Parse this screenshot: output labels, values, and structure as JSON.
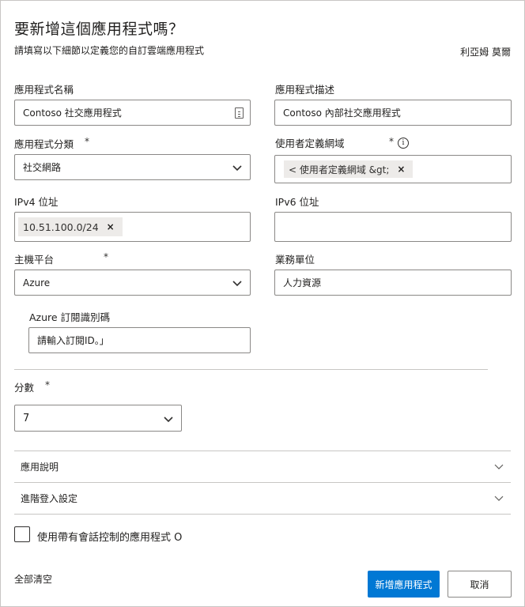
{
  "dialog": {
    "title": "要新增這個應用程式嗎？",
    "subtitle": "請填寫以下細節以定義您的自訂雲端應用程式",
    "user_name": "利亞姆 莫爾"
  },
  "fields": {
    "app_name": {
      "label": "應用程式名稱",
      "value": "Contoso 社交應用程式"
    },
    "app_description": {
      "label": "應用程式描述",
      "value": "Contoso 內部社交應用程式"
    },
    "app_category": {
      "label": "應用程式分類",
      "required_mark": "*",
      "value": "社交網路"
    },
    "user_domains": {
      "label": "使用者定義網域",
      "required_mark": "*",
      "info_icon": "i",
      "tag": "< 使用者定義網域 &gt;",
      "remove": "×"
    },
    "ipv4": {
      "label": "IPv4 位址",
      "tag": "10.51.100.0/24",
      "remove": "×"
    },
    "ipv6": {
      "label": "IPv6 位址",
      "value": ""
    },
    "hosting_platform": {
      "label": "主機平台",
      "required_mark": "*",
      "value": "Azure"
    },
    "business_unit": {
      "label": "業務單位",
      "value": "人力資源"
    },
    "azure_subscription": {
      "label": "Azure 訂閱識別碼",
      "value": "請輸入訂閱ID。」"
    },
    "score": {
      "label": "分數",
      "required_mark": "*",
      "value": "7"
    }
  },
  "expanders": {
    "app_notes": "應用說明",
    "advanced_login": "進階登入設定"
  },
  "session_control": {
    "label": "使用帶有會話控制的應用程式 O",
    "checked": false
  },
  "footer": {
    "clear_all": "全部清空",
    "add_app": "新增應用程式",
    "cancel": "取消"
  },
  "colors": {
    "primary": "#0078d4",
    "border": "#8a8886",
    "tag_bg": "#edebe9"
  }
}
